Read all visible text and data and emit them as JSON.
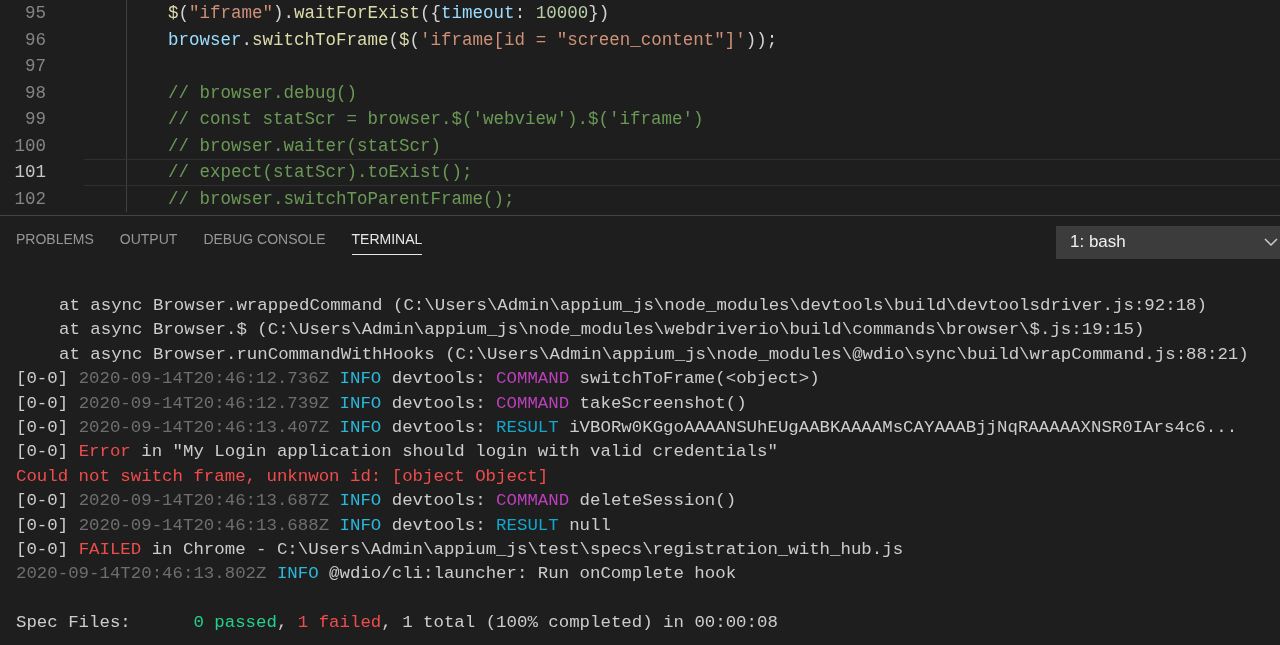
{
  "editor": {
    "lines": [
      {
        "number": "95",
        "current": false,
        "tokens": [
          {
            "kind": "fn",
            "text": "$"
          },
          {
            "kind": "plain",
            "text": "("
          },
          {
            "kind": "str",
            "text": "\"iframe\""
          },
          {
            "kind": "plain",
            "text": ")."
          },
          {
            "kind": "fn",
            "text": "waitForExist"
          },
          {
            "kind": "plain",
            "text": "({"
          },
          {
            "kind": "prop",
            "text": "timeout"
          },
          {
            "kind": "plain",
            "text": ": "
          },
          {
            "kind": "num",
            "text": "10000"
          },
          {
            "kind": "plain",
            "text": "})"
          }
        ]
      },
      {
        "number": "96",
        "current": false,
        "tokens": [
          {
            "kind": "prop",
            "text": "browser"
          },
          {
            "kind": "plain",
            "text": "."
          },
          {
            "kind": "fn",
            "text": "switchToFrame"
          },
          {
            "kind": "plain",
            "text": "("
          },
          {
            "kind": "fn",
            "text": "$"
          },
          {
            "kind": "plain",
            "text": "("
          },
          {
            "kind": "str",
            "text": "'iframe[id = \"screen_content\"]'"
          },
          {
            "kind": "plain",
            "text": "));"
          }
        ]
      },
      {
        "number": "97",
        "current": false
      },
      {
        "number": "98",
        "current": false,
        "tokens": [
          {
            "kind": "comment",
            "text": "// browser.debug()"
          }
        ]
      },
      {
        "number": "99",
        "current": false,
        "tokens": [
          {
            "kind": "comment",
            "text": "// const statScr = browser.$('webview').$('iframe')"
          }
        ]
      },
      {
        "number": "100",
        "current": false,
        "tokens": [
          {
            "kind": "comment",
            "text": "// browser.waiter(statScr)"
          }
        ]
      },
      {
        "number": "101",
        "current": true,
        "tokens": [
          {
            "kind": "comment",
            "text": "// expect(statScr).toExist();"
          }
        ]
      },
      {
        "number": "102",
        "current": false,
        "tokens": [
          {
            "kind": "comment",
            "text": "// browser.switchToParentFrame();"
          }
        ]
      }
    ]
  },
  "panel": {
    "tabs": [
      {
        "label": "PROBLEMS",
        "selected": false
      },
      {
        "label": "OUTPUT",
        "selected": false
      },
      {
        "label": "DEBUG CONSOLE",
        "selected": false
      },
      {
        "label": "TERMINAL",
        "selected": true
      }
    ],
    "terminal_select": "1: bash",
    "lines": [
      {
        "kind": "stack",
        "segments": [
          {
            "kind": "plain",
            "text": "at async Browser.wrappedCommand (C:\\Users\\Admin\\appium_js\\node_modules\\devtools\\build\\devtoolsdriver.js:92:18)"
          }
        ]
      },
      {
        "kind": "stack",
        "segments": [
          {
            "kind": "plain",
            "text": "at async Browser.$ (C:\\Users\\Admin\\appium_js\\node_modules\\webdriverio\\build\\commands\\browser\\$.js:19:15)"
          }
        ]
      },
      {
        "kind": "stack",
        "segments": [
          {
            "kind": "plain",
            "text": "at async Browser.runCommandWithHooks (C:\\Users\\Admin\\appium_js\\node_modules\\@wdio\\sync\\build\\wrapCommand.js:88:21)"
          }
        ]
      },
      {
        "kind": "log",
        "segments": [
          {
            "kind": "plain",
            "text": "[0-0] "
          },
          {
            "kind": "dim",
            "text": "2020-09-14T20:46:12.736Z "
          },
          {
            "kind": "info",
            "text": "INFO "
          },
          {
            "kind": "plain",
            "text": "devtools: "
          },
          {
            "kind": "cmd",
            "text": "COMMAND "
          },
          {
            "kind": "plain",
            "text": "switchToFrame(<object>)"
          }
        ]
      },
      {
        "kind": "log",
        "segments": [
          {
            "kind": "plain",
            "text": "[0-0] "
          },
          {
            "kind": "dim",
            "text": "2020-09-14T20:46:12.739Z "
          },
          {
            "kind": "info",
            "text": "INFO "
          },
          {
            "kind": "plain",
            "text": "devtools: "
          },
          {
            "kind": "cmd",
            "text": "COMMAND "
          },
          {
            "kind": "plain",
            "text": "takeScreenshot()"
          }
        ]
      },
      {
        "kind": "log",
        "segments": [
          {
            "kind": "plain",
            "text": "[0-0] "
          },
          {
            "kind": "dim",
            "text": "2020-09-14T20:46:13.407Z "
          },
          {
            "kind": "info",
            "text": "INFO "
          },
          {
            "kind": "plain",
            "text": "devtools: "
          },
          {
            "kind": "result",
            "text": "RESULT "
          },
          {
            "kind": "plain",
            "text": "iVBORw0KGgoAAAANSUhEUgAABKAAAAMsCAYAAABjjNqRAAAAAXNSR0IArs4c6..."
          }
        ]
      },
      {
        "kind": "log",
        "segments": [
          {
            "kind": "plain",
            "text": "[0-0] "
          },
          {
            "kind": "error",
            "text": "Error "
          },
          {
            "kind": "plain",
            "text": "in \"My Login application should login with valid credentials\""
          }
        ]
      },
      {
        "kind": "log",
        "segments": [
          {
            "kind": "error",
            "text": "Could not switch frame, unknwon id: [object Object]"
          }
        ]
      },
      {
        "kind": "log",
        "segments": [
          {
            "kind": "plain",
            "text": "[0-0] "
          },
          {
            "kind": "dim",
            "text": "2020-09-14T20:46:13.687Z "
          },
          {
            "kind": "info",
            "text": "INFO "
          },
          {
            "kind": "plain",
            "text": "devtools: "
          },
          {
            "kind": "cmd",
            "text": "COMMAND "
          },
          {
            "kind": "plain",
            "text": "deleteSession()"
          }
        ]
      },
      {
        "kind": "log",
        "segments": [
          {
            "kind": "plain",
            "text": "[0-0] "
          },
          {
            "kind": "dim",
            "text": "2020-09-14T20:46:13.688Z "
          },
          {
            "kind": "info",
            "text": "INFO "
          },
          {
            "kind": "plain",
            "text": "devtools: "
          },
          {
            "kind": "result",
            "text": "RESULT "
          },
          {
            "kind": "plain",
            "text": "null"
          }
        ]
      },
      {
        "kind": "log",
        "segments": [
          {
            "kind": "plain",
            "text": "[0-0] "
          },
          {
            "kind": "error",
            "text": "FAILED "
          },
          {
            "kind": "plain",
            "text": "in Chrome - C:\\Users\\Admin\\appium_js\\test\\specs\\registration_with_hub.js"
          }
        ]
      },
      {
        "kind": "log",
        "segments": [
          {
            "kind": "dim",
            "text": "2020-09-14T20:46:13.802Z "
          },
          {
            "kind": "info",
            "text": "INFO "
          },
          {
            "kind": "plain",
            "text": "@wdio/cli:launcher: Run onComplete hook"
          }
        ]
      },
      {
        "kind": "blank"
      },
      {
        "kind": "log",
        "segments": [
          {
            "kind": "plain",
            "text": "Spec Files:      "
          },
          {
            "kind": "pass",
            "text": "0 passed"
          },
          {
            "kind": "plain",
            "text": ", "
          },
          {
            "kind": "error",
            "text": "1 failed"
          },
          {
            "kind": "plain",
            "text": ", 1 total (100% completed) in 00:00:08"
          }
        ]
      }
    ]
  }
}
